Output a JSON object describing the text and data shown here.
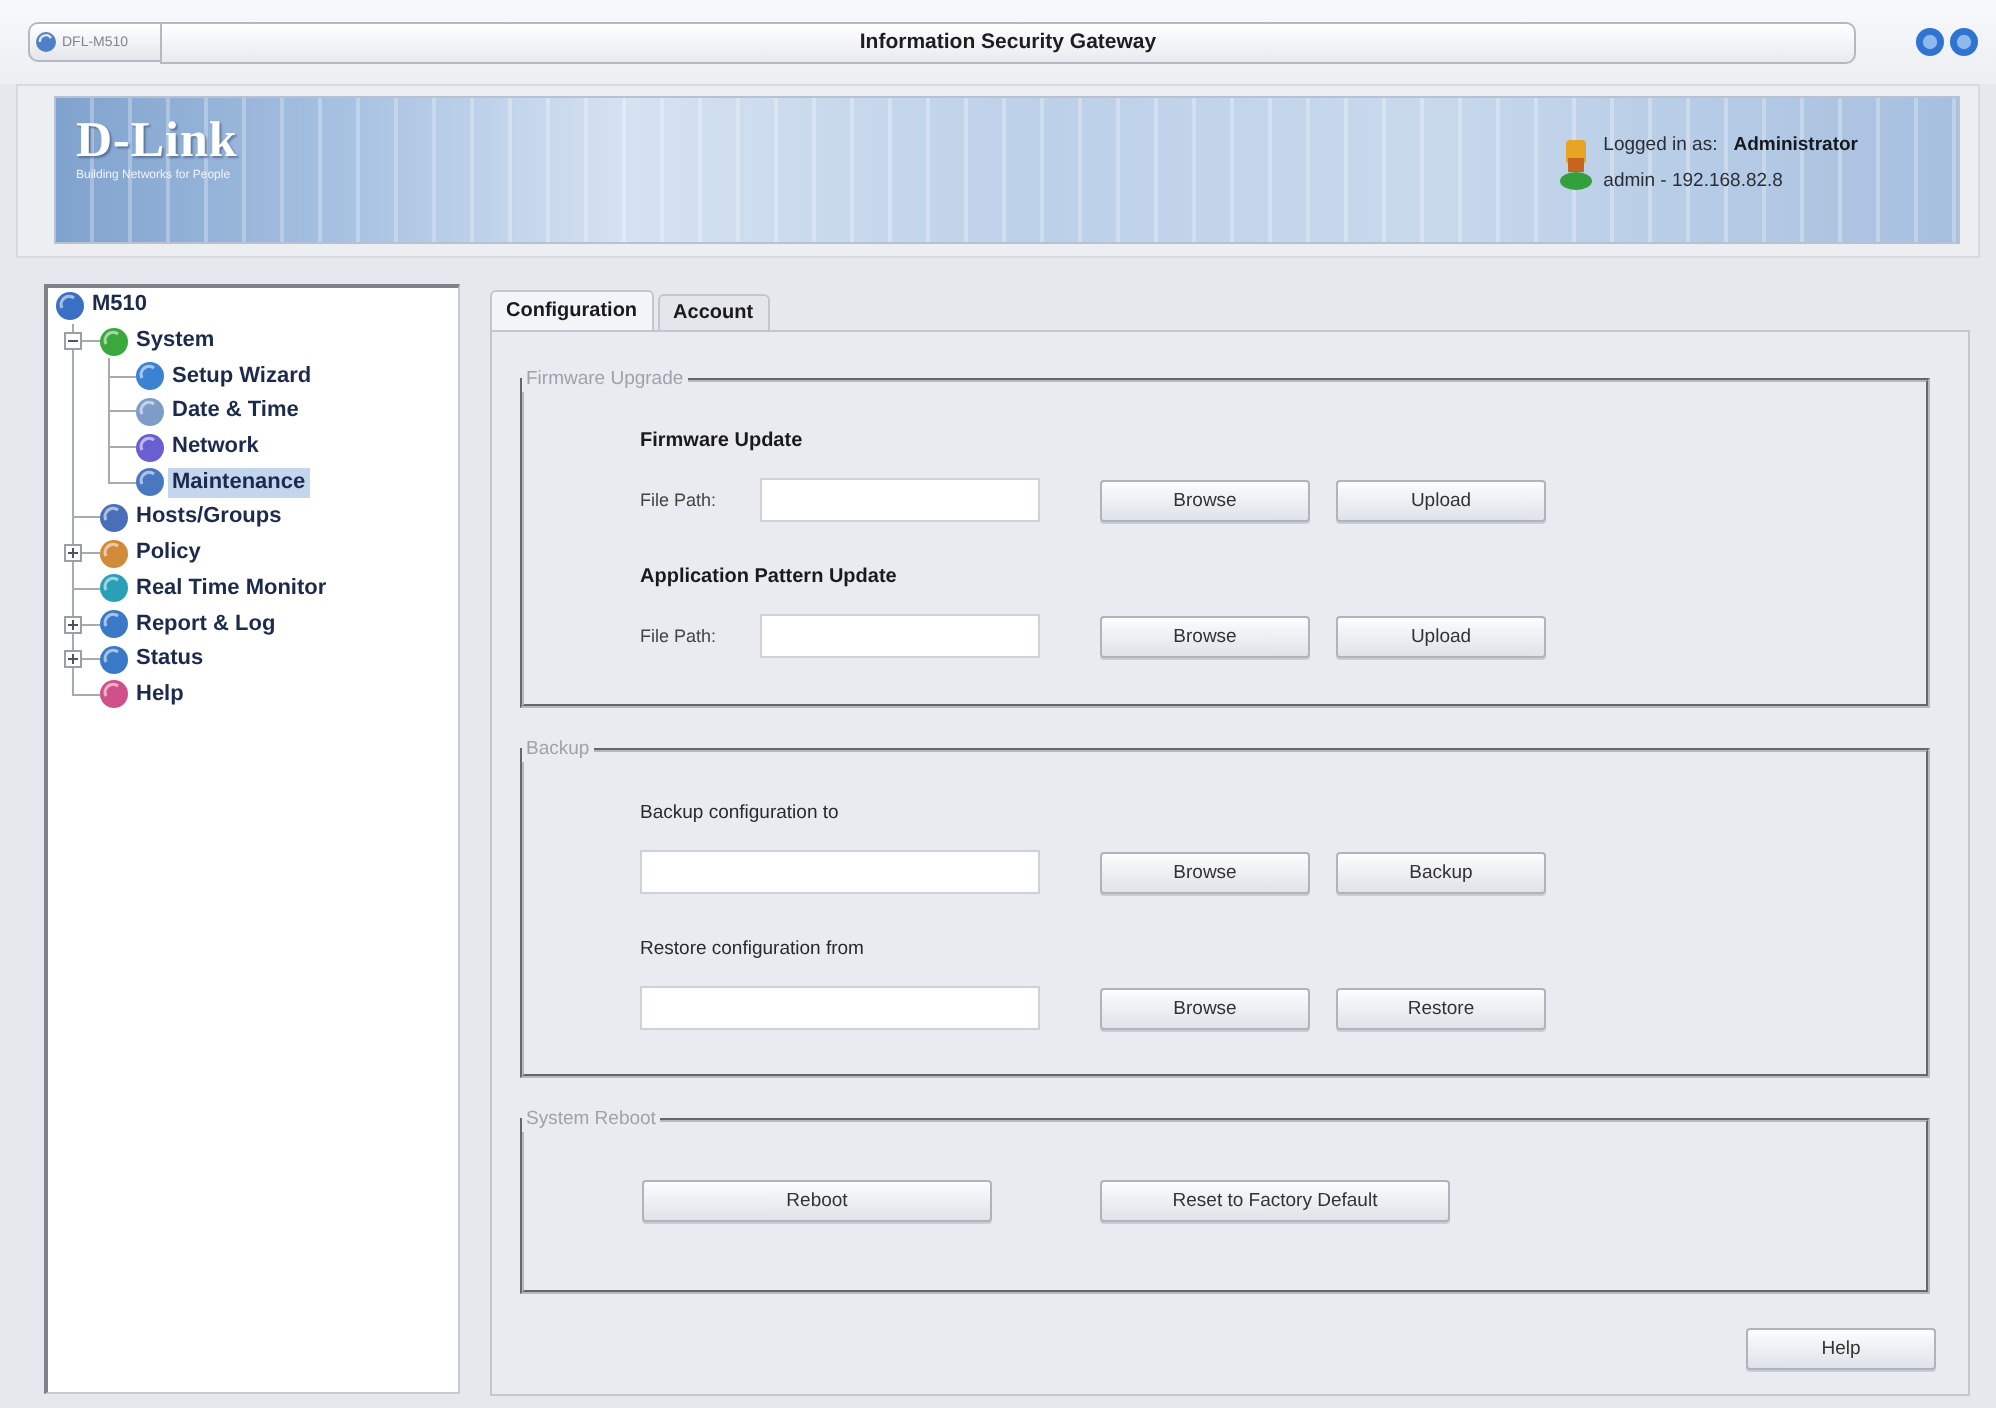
{
  "window": {
    "tab_label": "DFL-M510",
    "title": "Information Security Gateway"
  },
  "header": {
    "logo": "D-Link",
    "tagline": "Building Networks for People",
    "login_label": "Logged in as:",
    "user": "Administrator",
    "session": "admin - 192.168.82.8"
  },
  "sidebar": {
    "tree": {
      "label": "M510",
      "kind": "root",
      "selected": false,
      "color": "#3a6fc4",
      "children": [
        {
          "label": "System",
          "kind": "group",
          "expanded": true,
          "selected": false,
          "color": "#3aa83a",
          "children": [
            {
              "label": "Setup Wizard",
              "kind": "page",
              "selected": false,
              "color": "#3b82d4"
            },
            {
              "label": "Date & Time",
              "kind": "page",
              "selected": false,
              "color": "#7f9cc8"
            },
            {
              "label": "Network",
              "kind": "page",
              "selected": false,
              "color": "#6a5fd0"
            },
            {
              "label": "Maintenance",
              "kind": "page",
              "selected": true,
              "color": "#4a78c0"
            }
          ]
        },
        {
          "label": "Hosts/Groups",
          "kind": "page",
          "selected": false,
          "color": "#4a6fb8"
        },
        {
          "label": "Policy",
          "kind": "group",
          "expanded": false,
          "selected": false,
          "color": "#d08a3a"
        },
        {
          "label": "Real Time Monitor",
          "kind": "page",
          "selected": false,
          "color": "#2aa0b8"
        },
        {
          "label": "Report & Log",
          "kind": "group",
          "expanded": false,
          "selected": false,
          "color": "#3a78c8"
        },
        {
          "label": "Status",
          "kind": "group",
          "expanded": false,
          "selected": false,
          "color": "#3a78c8"
        },
        {
          "label": "Help",
          "kind": "page",
          "selected": false,
          "color": "#d0508a"
        }
      ]
    }
  },
  "tabs": [
    {
      "label": "Configuration",
      "selected": true
    },
    {
      "label": "Account",
      "selected": false
    }
  ],
  "sections": [
    {
      "kind": "upload",
      "legend": "Firmware Upgrade",
      "groups": [
        {
          "title": "Firmware Update",
          "field_label": "File Path:",
          "buttons": [
            "Browse",
            "Upload"
          ]
        },
        {
          "title": "Application Pattern Update",
          "field_label": "File Path:",
          "buttons": [
            "Browse",
            "Upload"
          ]
        }
      ]
    },
    {
      "kind": "file",
      "legend": "Backup",
      "groups": [
        {
          "title": "Backup configuration to",
          "buttons": [
            "Browse",
            "Backup"
          ]
        },
        {
          "title": "Restore configuration from",
          "buttons": [
            "Browse",
            "Restore"
          ]
        }
      ]
    },
    {
      "kind": "actions",
      "legend": "System Reboot",
      "buttons": [
        "Reboot",
        "Reset to Factory Default"
      ]
    }
  ],
  "help_button": "Help"
}
